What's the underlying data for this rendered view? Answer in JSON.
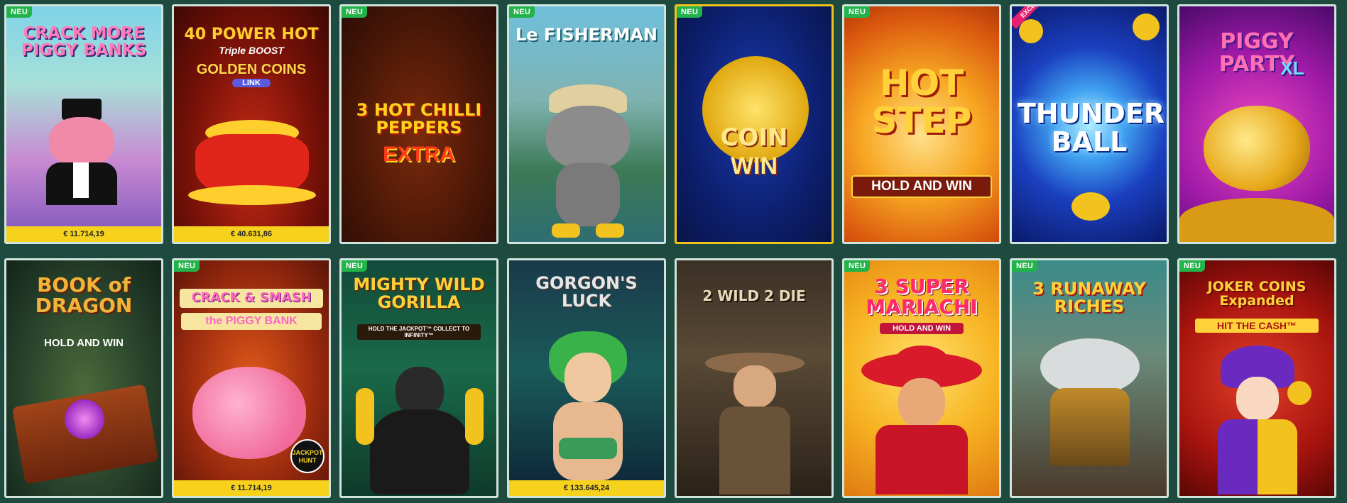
{
  "badge_label": "NEU",
  "exclusive_label": "EXCLUSIVE",
  "jackpot_hunt_label": "JACKPOT HUNT",
  "row1": [
    {
      "title": "CRACK MORE PIGGY BANKS",
      "subtitle": "",
      "new": true,
      "jackpot": "€ 11.714,19"
    },
    {
      "title": "40 POWER HOT",
      "subtitle": "Triple BOOST",
      "extra": "GOLDEN COINS",
      "extra2": "LINK",
      "new": false,
      "jackpot": "€ 40.631,86"
    },
    {
      "title": "3 HOT CHILLI PEPPERS",
      "subtitle": "EXTRA",
      "new": true,
      "jackpot": ""
    },
    {
      "title": "Le FISHERMAN",
      "subtitle": "",
      "new": true,
      "jackpot": ""
    },
    {
      "title": "COIN",
      "subtitle": "WIN",
      "new": true,
      "jackpot": ""
    },
    {
      "title": "HOT STEP",
      "subtitle": "HOLD AND WIN",
      "new": true,
      "jackpot": ""
    },
    {
      "title": "THUNDER BALL",
      "subtitle": "",
      "new": false,
      "exclusive": true,
      "jackpot": ""
    },
    {
      "title": "PIGGY PARTY",
      "subtitle": "XL",
      "new": false,
      "jackpot": ""
    }
  ],
  "row2": [
    {
      "title": "BOOK of DRAGON",
      "subtitle": "HOLD AND WIN",
      "new": false,
      "jackpot": ""
    },
    {
      "title": "CRACK & SMASH",
      "subtitle": "the PIGGY BANK",
      "new": true,
      "jackpot": "€ 11.714,19",
      "jackpot_hunt": true
    },
    {
      "title": "MIGHTY WILD GORILLA",
      "subtitle": "HOLD THE JACKPOT™ COLLECT TO INFINITY™",
      "new": true,
      "jackpot": ""
    },
    {
      "title": "GORGON'S LUCK",
      "subtitle": "",
      "new": false,
      "jackpot": "€ 133.645,24"
    },
    {
      "title": "2 WILD 2 DIE",
      "subtitle": "",
      "new": false,
      "jackpot": ""
    },
    {
      "title": "3 SUPER MARIACHI",
      "subtitle": "HOLD AND WIN",
      "new": true,
      "jackpot": ""
    },
    {
      "title": "3 RUNAWAY RICHES",
      "subtitle": "",
      "new": true,
      "jackpot": ""
    },
    {
      "title": "JOKER COINS Expanded",
      "subtitle": "HIT THE CASH™",
      "new": true,
      "jackpot": ""
    }
  ],
  "colors": {
    "badge": "#22b34a",
    "jackpot_bar": "#f6d21d",
    "background": "#1f4a3f",
    "tile_border": "#cfe4dc"
  }
}
